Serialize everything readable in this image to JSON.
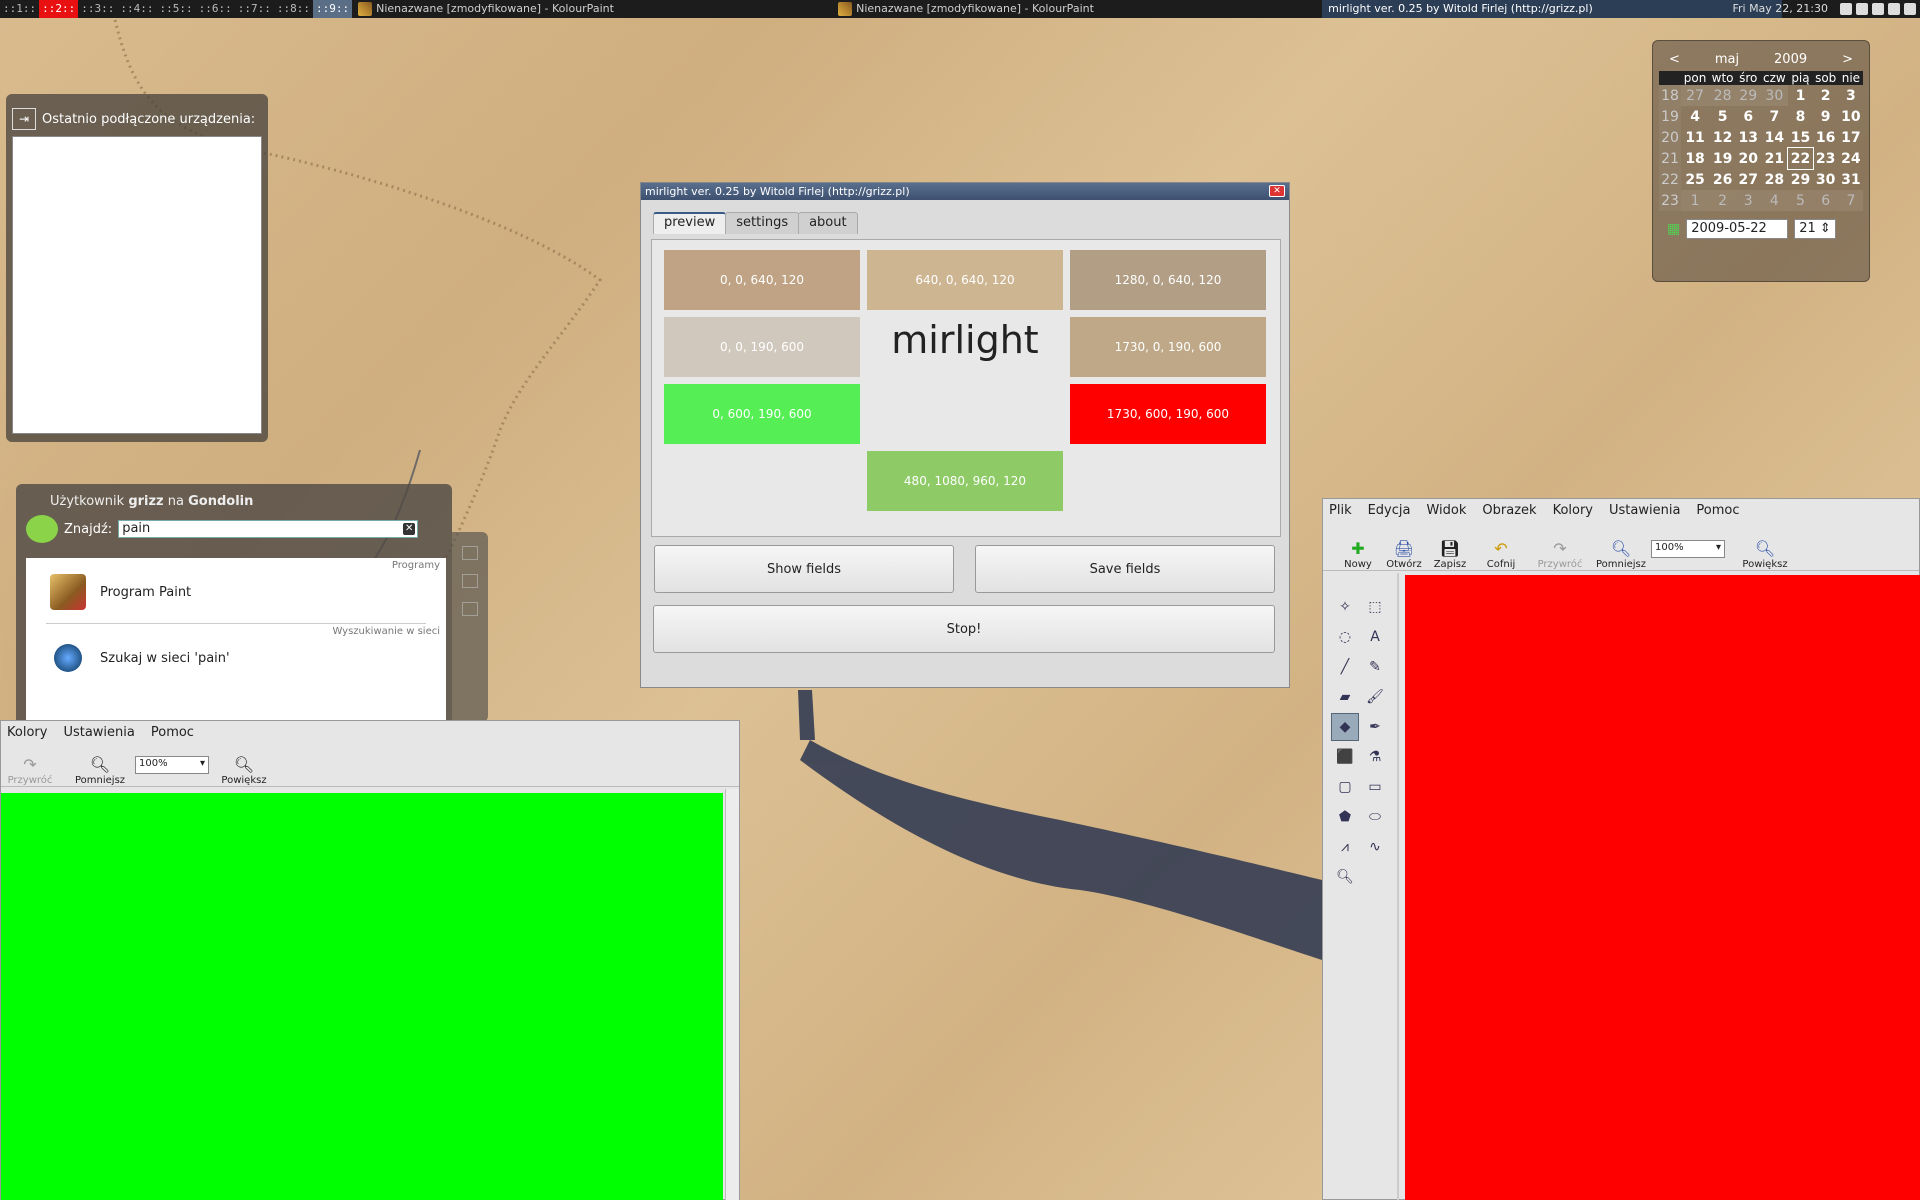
{
  "taskbar": {
    "workspaces": [
      "::1::",
      "::2::",
      "::3::",
      "::4::",
      "::5::",
      "::6::",
      "::7::",
      "::8::",
      "::9::"
    ],
    "tasks": [
      "Nienazwane [zmodyfikowane] - KolourPaint",
      "Nienazwane [zmodyfikowane] - KolourPaint",
      "mirlight ver. 0.25 by Witold Firlej (http://grizz.pl)"
    ],
    "clock": "Fri May 22, 21:30"
  },
  "calendar": {
    "prev": "<",
    "next": ">",
    "month": "maj",
    "year": "2009",
    "days": [
      "pon",
      "wto",
      "śro",
      "czw",
      "pią",
      "sob",
      "nie"
    ],
    "weeks": [
      {
        "wk": "18",
        "d": [
          "27",
          "28",
          "29",
          "30",
          "1",
          "2",
          "3"
        ]
      },
      {
        "wk": "19",
        "d": [
          "4",
          "5",
          "6",
          "7",
          "8",
          "9",
          "10"
        ]
      },
      {
        "wk": "20",
        "d": [
          "11",
          "12",
          "13",
          "14",
          "15",
          "16",
          "17"
        ]
      },
      {
        "wk": "21",
        "d": [
          "18",
          "19",
          "20",
          "21",
          "22",
          "23",
          "24"
        ]
      },
      {
        "wk": "22",
        "d": [
          "25",
          "26",
          "27",
          "28",
          "29",
          "30",
          "31"
        ]
      },
      {
        "wk": "23",
        "d": [
          "1",
          "2",
          "3",
          "4",
          "5",
          "6",
          "7"
        ]
      }
    ],
    "date_value": "2009-05-22",
    "week_value": "21"
  },
  "devices": {
    "title": "Ostatnio podłączone urządzenia:"
  },
  "krunner": {
    "title_prefix": "Użytkownik",
    "user": "grizz",
    "title_mid": "na",
    "host": "Gondolin",
    "search_label": "Znajdź:",
    "search_value": "pain",
    "results": [
      {
        "category": "Programy",
        "label": "Program Paint"
      },
      {
        "category": "Wyszukiwanie w sieci",
        "label": "Szukaj w sieci 'pain'"
      }
    ]
  },
  "kpleft": {
    "menu": [
      "Kolory",
      "Ustawienia",
      "Pomoc"
    ],
    "redo": "Przywróć",
    "zoom_out": "Pomniejsz",
    "zoom_value": "100%",
    "zoom_in": "Powiększ",
    "canvas_color": "#00ff00"
  },
  "mirlight": {
    "title": "mirlight ver. 0.25 by Witold Firlej (http://grizz.pl)",
    "tabs": [
      "preview",
      "settings",
      "about"
    ],
    "center_text": "mirlight",
    "fields": [
      {
        "label": "0, 0, 640, 120",
        "color": "#bfa384"
      },
      {
        "label": "640, 0, 640, 120",
        "color": "#cdb592"
      },
      {
        "label": "1280, 0, 640, 120",
        "color": "#b19e85"
      },
      {
        "label": "0, 0, 190, 600",
        "color": "#d0c8bc"
      },
      {
        "label": "1730, 0, 190, 600",
        "color": "#bea887"
      },
      {
        "label": "0, 600, 190, 600",
        "color": "#55ef55"
      },
      {
        "label": "1730, 600, 190, 600",
        "color": "#ff0000"
      },
      {
        "label": "480, 1080, 960, 120",
        "color": "#8ecb66"
      }
    ],
    "show_fields": "Show fields",
    "save_fields": "Save fields",
    "stop": "Stop!"
  },
  "kpright": {
    "menu": [
      "Plik",
      "Edycja",
      "Widok",
      "Obrazek",
      "Kolory",
      "Ustawienia",
      "Pomoc"
    ],
    "toolbar": [
      "Nowy",
      "Otwórz",
      "Zapisz",
      "Cofnij",
      "Przywróć",
      "Pomniejsz",
      "Powiększ"
    ],
    "zoom_value": "100%",
    "canvas_color": "#ff0000"
  }
}
